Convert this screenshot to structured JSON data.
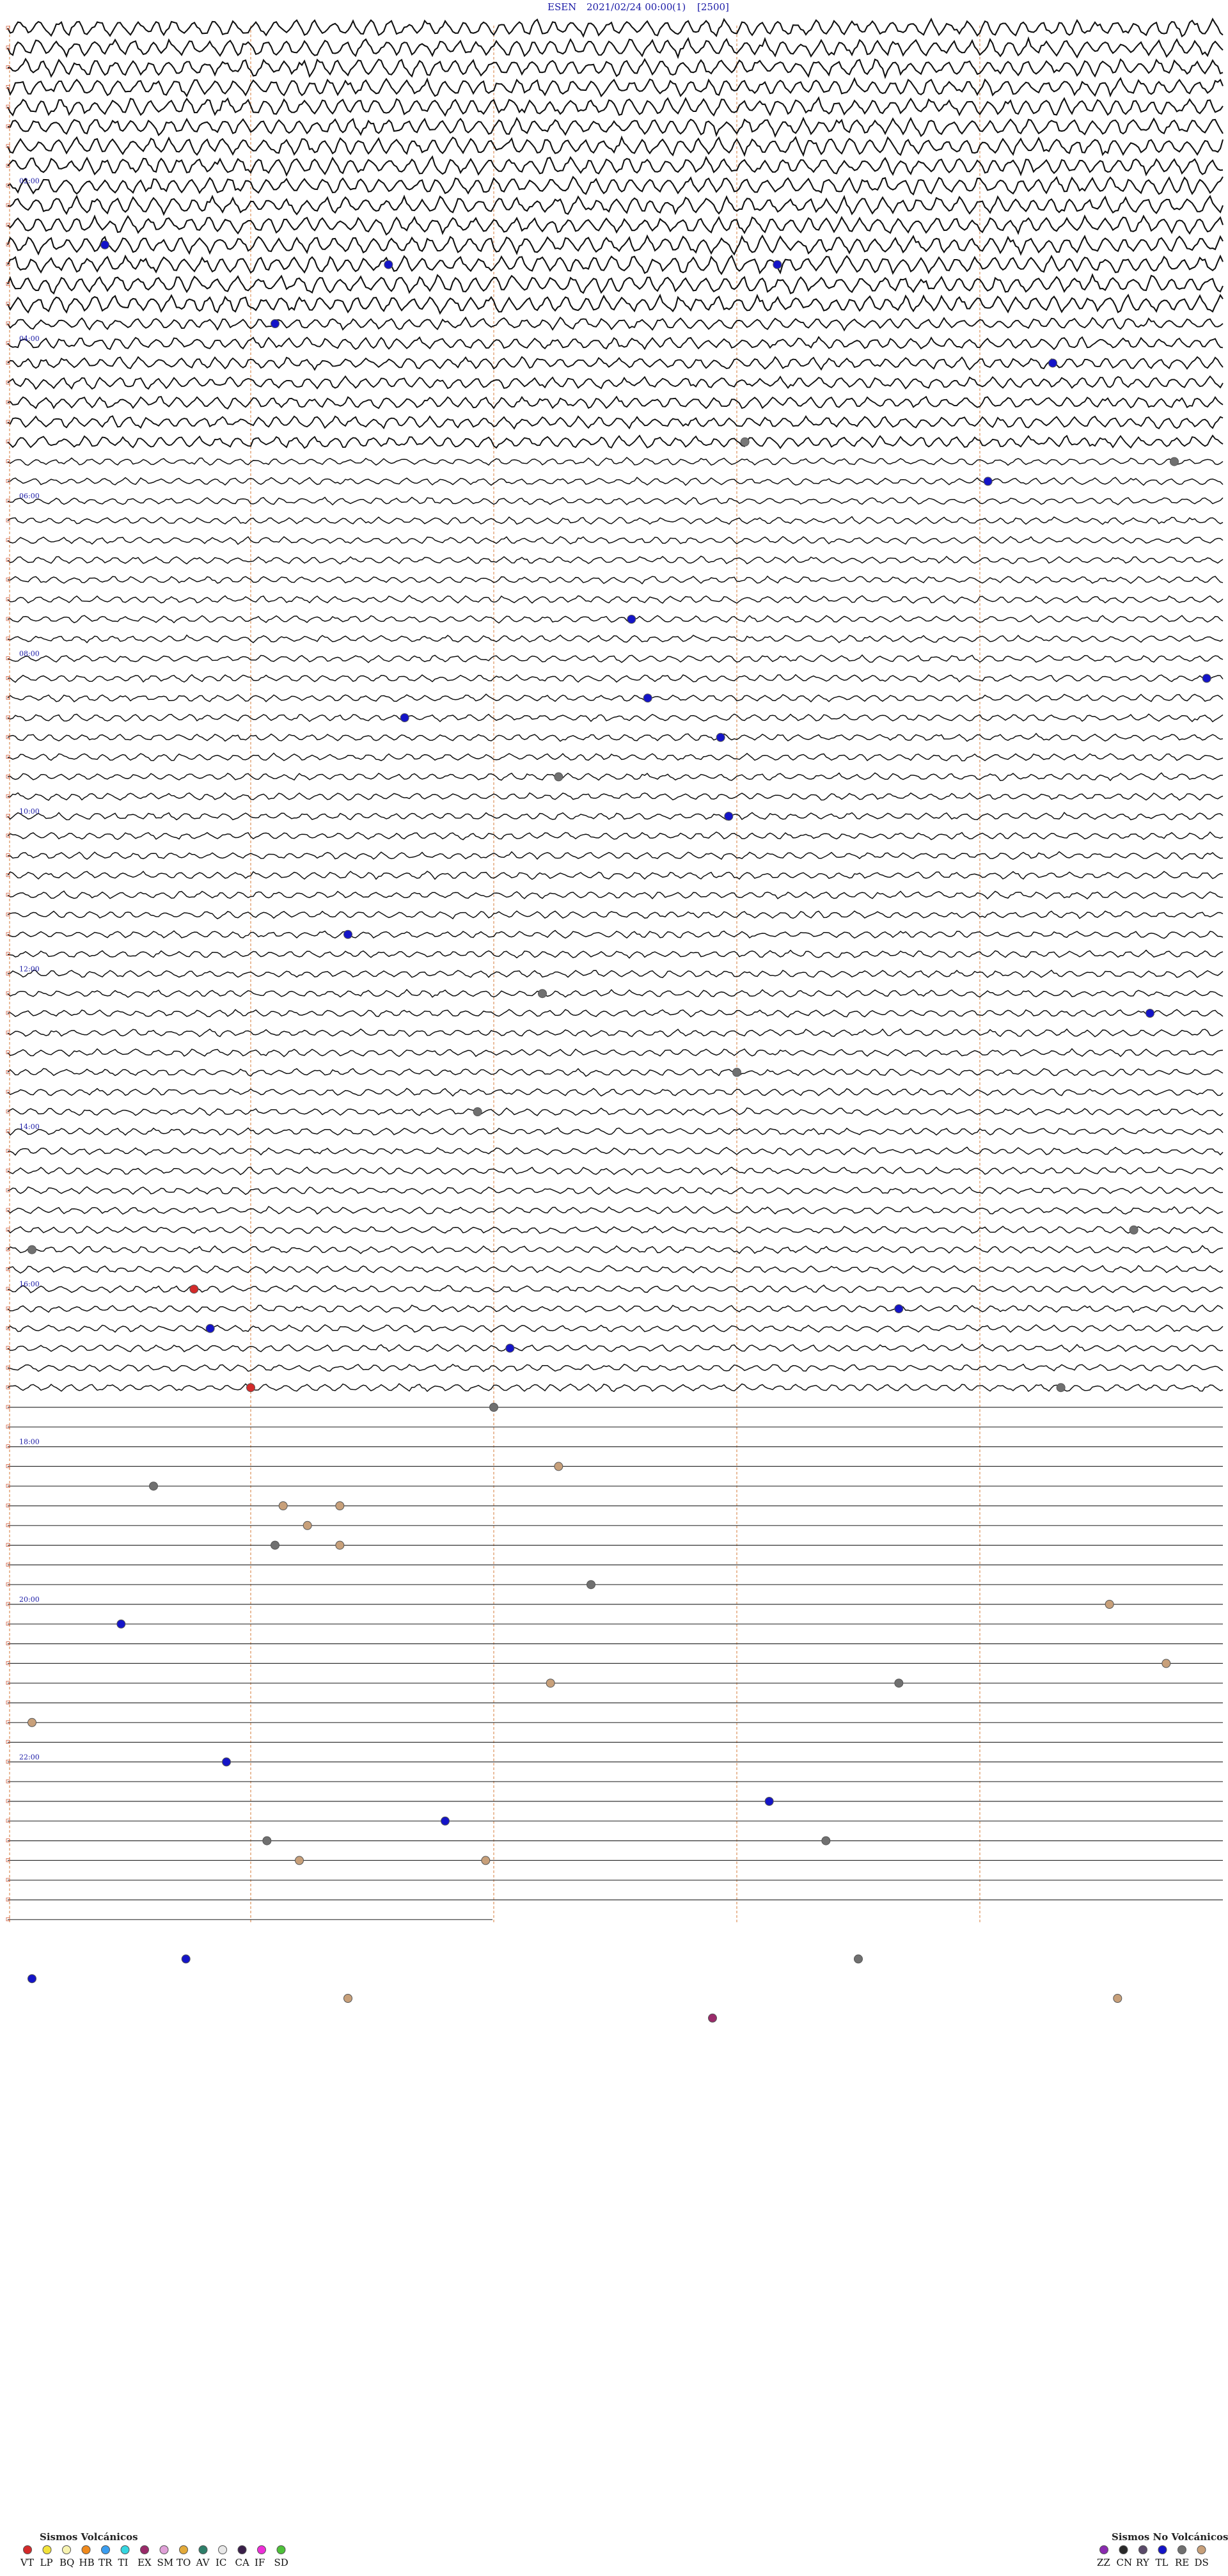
{
  "header": {
    "station": "ESEN",
    "datetime": "2021/02/24 00:00",
    "channel": "(1)",
    "scale": "[2500]"
  },
  "chart_data": {
    "type": "helicorder",
    "title": "ESEN    2021/02/24 00:00    (1)    [2500]",
    "hour_labels": [
      {
        "row": 8,
        "text": "02:00"
      },
      {
        "row": 16,
        "text": "04:00"
      },
      {
        "row": 24,
        "text": "06:00"
      },
      {
        "row": 32,
        "text": "08:00"
      },
      {
        "row": 40,
        "text": "10:00"
      },
      {
        "row": 48,
        "text": "12:00"
      },
      {
        "row": 56,
        "text": "14:00"
      },
      {
        "row": 64,
        "text": "16:00"
      },
      {
        "row": 72,
        "text": "18:00"
      },
      {
        "row": 80,
        "text": "20:00"
      },
      {
        "row": 88,
        "text": "22:00"
      }
    ],
    "rows_per_hour": 4,
    "minutes_per_row": 15,
    "total_rows": 97,
    "active_rows": 70,
    "grid": {
      "vertical_dashed_minutes": [
        0,
        3,
        6,
        9,
        12
      ],
      "color": "#e0a070"
    },
    "event_markers": [
      {
        "type": "TL",
        "row": 11,
        "minute": 1.2
      },
      {
        "type": "TL",
        "row": 12,
        "minute": 9.5
      },
      {
        "type": "TL",
        "row": 12,
        "minute": 4.7
      },
      {
        "type": "TL",
        "row": 15,
        "minute": 3.3
      },
      {
        "type": "TL",
        "row": 17,
        "minute": 12.9
      },
      {
        "type": "BE",
        "row": 21,
        "minute": 9.1
      },
      {
        "type": "RE",
        "row": 22,
        "minute": 14.4
      },
      {
        "type": "TL",
        "row": 23,
        "minute": 12.1
      },
      {
        "type": "TL",
        "row": 30,
        "minute": 7.7
      },
      {
        "type": "TL",
        "row": 33,
        "minute": 14.8
      },
      {
        "type": "TL",
        "row": 34,
        "minute": 7.9
      },
      {
        "type": "TL",
        "row": 35,
        "minute": 4.9
      },
      {
        "type": "TL",
        "row": 36,
        "minute": 8.8
      },
      {
        "type": "RE",
        "row": 38,
        "minute": 6.8
      },
      {
        "type": "TL",
        "row": 40,
        "minute": 8.9
      },
      {
        "type": "TL",
        "row": 46,
        "minute": 4.2
      },
      {
        "type": "RE",
        "row": 49,
        "minute": 6.6
      },
      {
        "type": "TL",
        "row": 50,
        "minute": 14.1
      },
      {
        "type": "RE",
        "row": 53,
        "minute": 9.0
      },
      {
        "type": "RE",
        "row": 55,
        "minute": 5.8
      },
      {
        "type": "RE",
        "row": 61,
        "minute": 13.9
      },
      {
        "type": "RE",
        "row": 62,
        "minute": 0.3
      },
      {
        "type": "VT",
        "row": 64,
        "minute": 2.3
      },
      {
        "type": "TL",
        "row": 65,
        "minute": 11.0
      },
      {
        "type": "TL",
        "row": 66,
        "minute": 2.5
      },
      {
        "type": "TL",
        "row": 67,
        "minute": 6.2
      },
      {
        "type": "VT",
        "row": 69,
        "minute": 3.0
      },
      {
        "type": "RE",
        "row": 69,
        "minute": 13.0
      },
      {
        "type": "RE",
        "row": 70,
        "minute": 6.0
      },
      {
        "type": "DS",
        "row": 73,
        "minute": 6.8
      },
      {
        "type": "RE",
        "row": 74,
        "minute": 1.8
      },
      {
        "type": "DS",
        "row": 75,
        "minute": 3.4
      },
      {
        "type": "DS",
        "row": 75,
        "minute": 4.1
      },
      {
        "type": "DS",
        "row": 76,
        "minute": 3.7
      },
      {
        "type": "DS",
        "row": 77,
        "minute": 4.1
      },
      {
        "type": "RE",
        "row": 77,
        "minute": 3.3
      },
      {
        "type": "RE",
        "row": 79,
        "minute": 7.2
      },
      {
        "type": "DS",
        "row": 80,
        "minute": 13.6
      },
      {
        "type": "TL",
        "row": 81,
        "minute": 1.4
      },
      {
        "type": "DS",
        "row": 83,
        "minute": 14.3
      },
      {
        "type": "DS",
        "row": 84,
        "minute": 6.7
      },
      {
        "type": "RE",
        "row": 84,
        "minute": 11.0
      },
      {
        "type": "DS",
        "row": 86,
        "minute": 0.3
      },
      {
        "type": "TL",
        "row": 88,
        "minute": 2.7
      },
      {
        "type": "TL",
        "row": 90,
        "minute": 9.4
      },
      {
        "type": "TL",
        "row": 91,
        "minute": 5.4
      },
      {
        "type": "RE",
        "row": 92,
        "minute": 3.2
      },
      {
        "type": "RE",
        "row": 92,
        "minute": 10.1
      },
      {
        "type": "DS",
        "row": 93,
        "minute": 5.9
      },
      {
        "type": "DS",
        "row": 93,
        "minute": 3.6
      },
      {
        "type": "TL",
        "row": 98,
        "minute": 2.2
      },
      {
        "type": "RE",
        "row": 98,
        "minute": 10.5
      },
      {
        "type": "TL",
        "row": 99,
        "minute": 0.3
      },
      {
        "type": "DS",
        "row": 100,
        "minute": 4.2
      },
      {
        "type": "DS",
        "row": 100,
        "minute": 13.7
      },
      {
        "type": "EX",
        "row": 101,
        "minute": 8.7
      }
    ],
    "legend": {
      "volcanic": {
        "title": "Sismos Volcánicos",
        "items": [
          {
            "code": "VT",
            "color": "#d42a2a"
          },
          {
            "code": "LP",
            "color": "#f2e23a"
          },
          {
            "code": "BQ",
            "color": "#f7f3b0"
          },
          {
            "code": "HB",
            "color": "#f08a1c"
          },
          {
            "code": "TR",
            "color": "#3a9ef0"
          },
          {
            "code": "TI",
            "color": "#35d6e0"
          },
          {
            "code": "EX",
            "color": "#9a2a6a"
          },
          {
            "code": "SM",
            "color": "#e0a0d8"
          },
          {
            "code": "TO",
            "color": "#e3aa3a"
          },
          {
            "code": "AV",
            "color": "#2e7f6a"
          },
          {
            "code": "IC",
            "color": "#e8e8e8"
          },
          {
            "code": "CA",
            "color": "#3a1f4a"
          },
          {
            "code": "IF",
            "color": "#ee2ed8"
          },
          {
            "code": "SD",
            "color": "#4ec23a"
          }
        ]
      },
      "non_volcanic": {
        "title": "Sismos No Volcánicos",
        "items": [
          {
            "code": "ZZ",
            "color": "#8a2ab0"
          },
          {
            "code": "CN",
            "color": "#2a2a2a"
          },
          {
            "code": "RY",
            "color": "#5a4a6a"
          },
          {
            "code": "TL",
            "color": "#1414c8"
          },
          {
            "code": "RE",
            "color": "#707070"
          },
          {
            "code": "DS",
            "color": "#c8a07a"
          }
        ]
      }
    }
  }
}
